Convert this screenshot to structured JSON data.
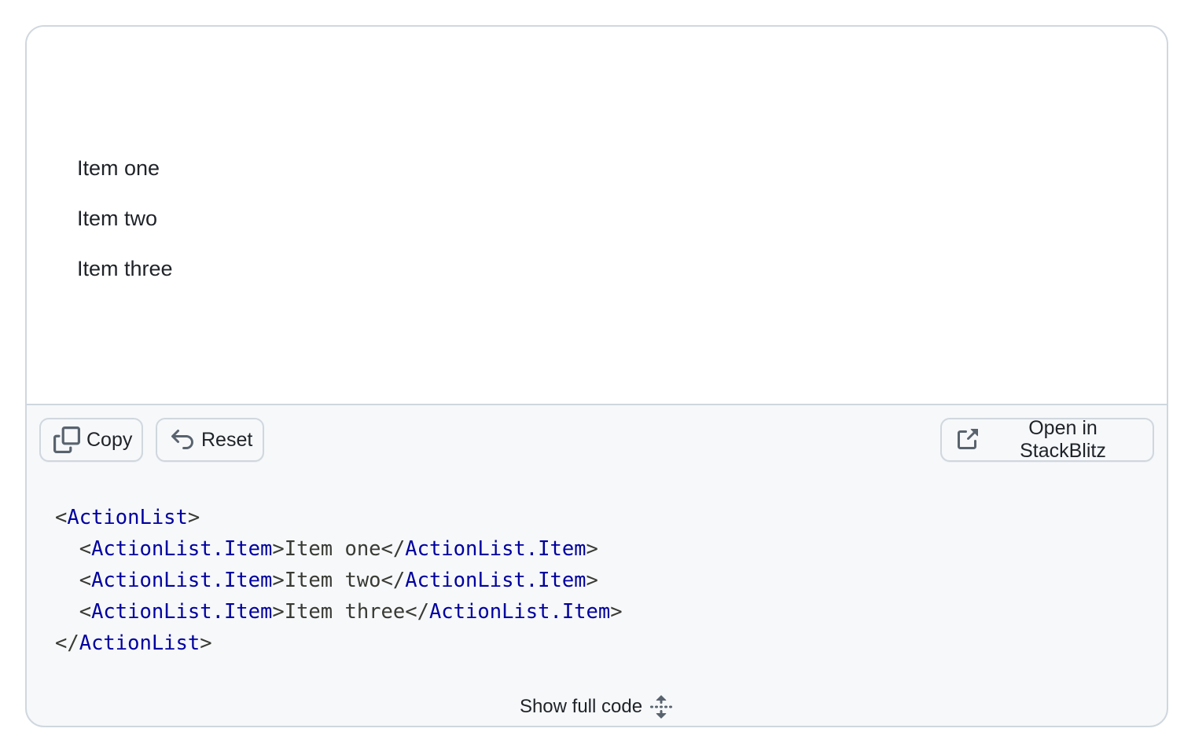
{
  "preview": {
    "items": [
      {
        "label": "Item one"
      },
      {
        "label": "Item two"
      },
      {
        "label": "Item three"
      }
    ]
  },
  "toolbar": {
    "copy_label": "Copy",
    "copy_icon": "copy-icon",
    "reset_label": "Reset",
    "reset_icon": "undo-icon",
    "stackblitz_label": "Open in StackBlitz",
    "stackblitz_icon": "link-external-icon"
  },
  "code": {
    "lines": [
      [
        {
          "t": "punct",
          "v": "<"
        },
        {
          "t": "tag",
          "v": "ActionList"
        },
        {
          "t": "punct",
          "v": ">"
        }
      ],
      [
        {
          "t": "punct",
          "v": "  <"
        },
        {
          "t": "tag",
          "v": "ActionList.Item"
        },
        {
          "t": "punct",
          "v": ">Item one</"
        },
        {
          "t": "tag",
          "v": "ActionList.Item"
        },
        {
          "t": "punct",
          "v": ">"
        }
      ],
      [
        {
          "t": "punct",
          "v": "  <"
        },
        {
          "t": "tag",
          "v": "ActionList.Item"
        },
        {
          "t": "punct",
          "v": ">Item two</"
        },
        {
          "t": "tag",
          "v": "ActionList.Item"
        },
        {
          "t": "punct",
          "v": ">"
        }
      ],
      [
        {
          "t": "punct",
          "v": "  <"
        },
        {
          "t": "tag",
          "v": "ActionList.Item"
        },
        {
          "t": "punct",
          "v": ">Item three</"
        },
        {
          "t": "tag",
          "v": "ActionList.Item"
        },
        {
          "t": "punct",
          "v": ">"
        }
      ],
      [
        {
          "t": "punct",
          "v": "</"
        },
        {
          "t": "tag",
          "v": "ActionList"
        },
        {
          "t": "punct",
          "v": ">"
        }
      ]
    ]
  },
  "show_full_code": {
    "label": "Show full code",
    "icon": "unfold-icon"
  },
  "colors": {
    "border": "#d0d7de",
    "code_tag": "#00009f",
    "code_text": "#393a34",
    "toolbar_bg": "#f6f8fa"
  }
}
